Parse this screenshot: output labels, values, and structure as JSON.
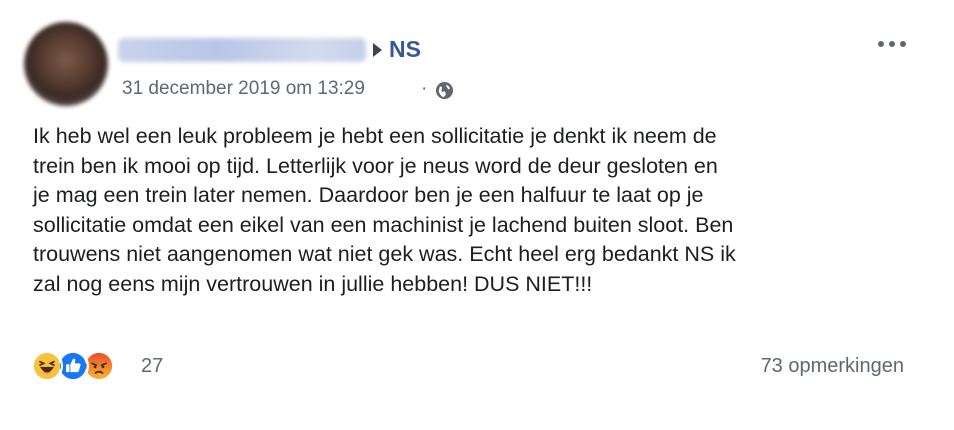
{
  "header": {
    "target_page": "NS",
    "timestamp": "31 december 2019 om 13:29",
    "separator": "·"
  },
  "post": {
    "lines": [
      "Ik heb wel een leuk probleem je hebt een sollicitatie je denkt ik neem de",
      "trein ben ik mooi op tijd. Letterlijk voor je neus word de deur gesloten en",
      "je mag een trein later nemen. Daardoor ben je een halfuur te laat op je",
      "sollicitatie omdat een eikel van een machinist je lachend buiten sloot. Ben",
      "trouwens niet aangenomen wat niet gek was. Echt heel erg bedankt NS ik",
      "zal nog eens mijn vertrouwen in jullie hebben! DUS NIET!!!"
    ]
  },
  "footer": {
    "reactions": [
      "haha",
      "like",
      "angry"
    ],
    "reaction_count": "27",
    "comments": "73 opmerkingen"
  },
  "colors": {
    "link": "#365899",
    "meta": "#606770",
    "like": "#1877f2"
  }
}
